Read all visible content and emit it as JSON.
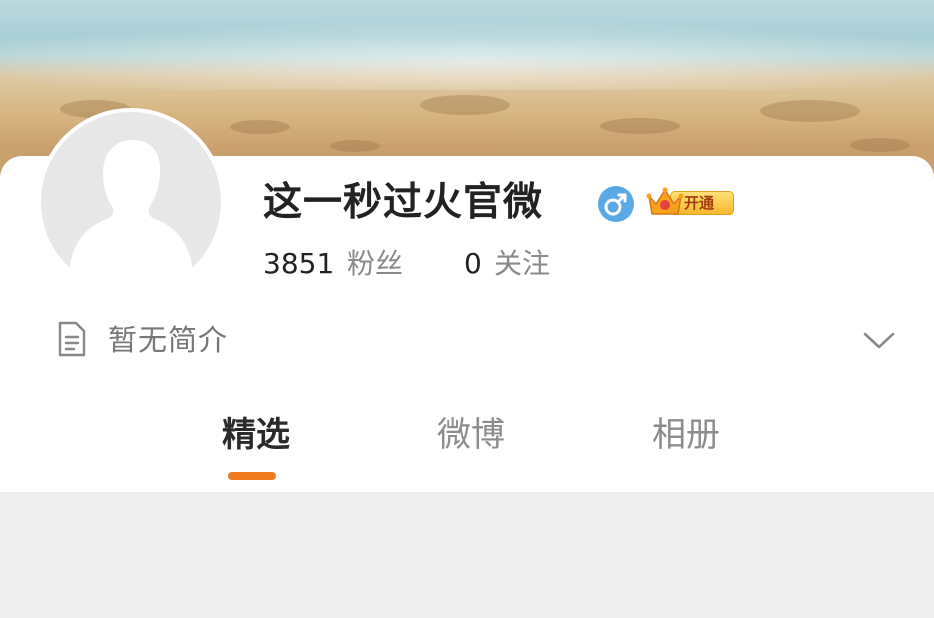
{
  "profile": {
    "name": "这一秒过火官微",
    "gender_icon": "male-symbol-icon",
    "gender_color": "#5aa9e6",
    "vip_badge_label": "开通",
    "avatar": "default-avatar-placeholder",
    "stats": {
      "followers_count": "3851",
      "followers_label": "粉丝",
      "following_count": "0",
      "following_label": "关注"
    },
    "intro_icon": "document-icon",
    "intro_text": "暂无简介",
    "expand_icon": "chevron-down-icon"
  },
  "tabs": [
    {
      "label": "精选",
      "active": true
    },
    {
      "label": "微博",
      "active": false
    },
    {
      "label": "相册",
      "active": false
    }
  ],
  "colors": {
    "accent": "#ee7a1d",
    "page_background": "#efefef"
  }
}
